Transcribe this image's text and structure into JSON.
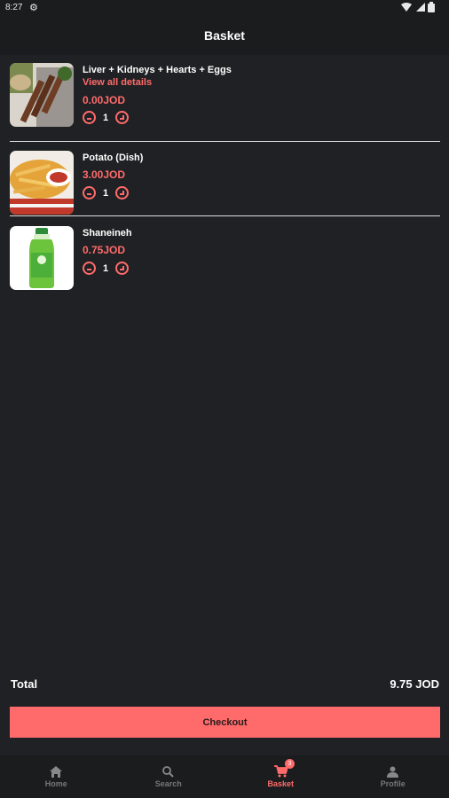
{
  "status_bar": {
    "time": "8:27",
    "settings_icon": "gear-icon",
    "wifi_icon": "wifi-icon",
    "signal_icon": "signal-icon",
    "battery_icon": "battery-icon"
  },
  "header": {
    "title": "Basket"
  },
  "items": [
    {
      "name": "Liver + Kidneys + Hearts + Eggs",
      "details_link": "View all details",
      "price": "0.00JOD",
      "quantity": "1"
    },
    {
      "name": "Potato (Dish)",
      "price": "3.00JOD",
      "quantity": "1"
    },
    {
      "name": "Shaneineh",
      "price": "0.75JOD",
      "quantity": "1"
    }
  ],
  "summary": {
    "total_label": "Total",
    "total_value": "9.75 JOD"
  },
  "checkout": {
    "label": "Checkout"
  },
  "nav": {
    "items": [
      {
        "label": "Home",
        "icon": "home-icon"
      },
      {
        "label": "Search",
        "icon": "search-icon"
      },
      {
        "label": "Basket",
        "icon": "cart-icon",
        "badge": "3"
      },
      {
        "label": "Profile",
        "icon": "profile-icon"
      }
    ]
  },
  "colors": {
    "accent": "#ff6b6b",
    "background": "#202124",
    "bar": "#1b1c1e"
  }
}
